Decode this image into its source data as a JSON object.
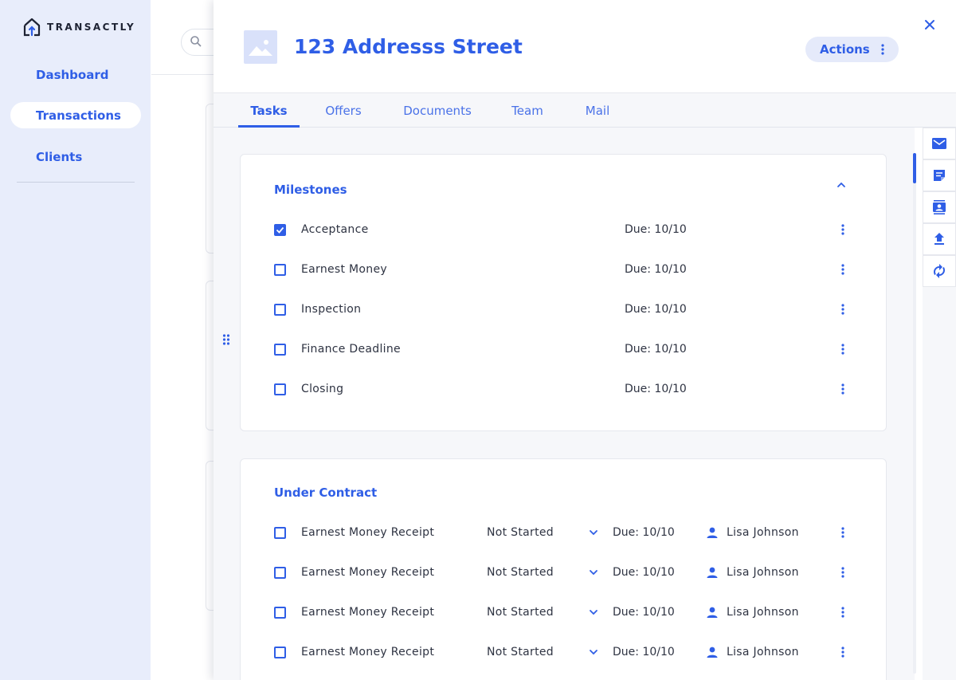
{
  "brand": {
    "name": "TRANSACTLY"
  },
  "sidebar": {
    "items": [
      {
        "label": "Dashboard",
        "active": false
      },
      {
        "label": "Transactions",
        "active": true
      },
      {
        "label": "Clients",
        "active": false
      }
    ]
  },
  "drawer": {
    "title": "123 Addresss Street",
    "actions_label": "Actions",
    "close_icon": "close-icon",
    "tabs": [
      {
        "label": "Tasks",
        "active": true
      },
      {
        "label": "Offers",
        "active": false
      },
      {
        "label": "Documents",
        "active": false
      },
      {
        "label": "Team",
        "active": false
      },
      {
        "label": "Mail",
        "active": false
      }
    ]
  },
  "milestones": {
    "title": "Milestones",
    "collapse_icon": "chevron-up-icon",
    "items": [
      {
        "label": "Acceptance",
        "due": "Due: 10/10",
        "checked": true
      },
      {
        "label": "Earnest Money",
        "due": "Due: 10/10",
        "checked": false
      },
      {
        "label": "Inspection",
        "due": "Due: 10/10",
        "checked": false
      },
      {
        "label": "Finance Deadline",
        "due": "Due: 10/10",
        "checked": false
      },
      {
        "label": "Closing",
        "due": "Due: 10/10",
        "checked": false
      }
    ]
  },
  "under_contract": {
    "title": "Under Contract",
    "items": [
      {
        "label": "Earnest Money Receipt",
        "status": "Not Started",
        "due": "Due: 10/10",
        "assignee": "Lisa Johnson",
        "checked": false
      },
      {
        "label": "Earnest Money Receipt",
        "status": "Not Started",
        "due": "Due: 10/10",
        "assignee": "Lisa Johnson",
        "checked": false
      },
      {
        "label": "Earnest Money Receipt",
        "status": "Not Started",
        "due": "Due: 10/10",
        "assignee": "Lisa Johnson",
        "checked": false
      },
      {
        "label": "Earnest Money Receipt",
        "status": "Not Started",
        "due": "Due: 10/10",
        "assignee": "Lisa Johnson",
        "checked": false
      }
    ]
  },
  "rail": {
    "buttons": [
      "mail-icon",
      "note-icon",
      "contacts-icon",
      "upload-icon",
      "sync-icon"
    ]
  },
  "colors": {
    "accent": "#2f5ee6",
    "sidebar_bg": "#e8edfb",
    "content_bg": "#f6f7fa"
  }
}
